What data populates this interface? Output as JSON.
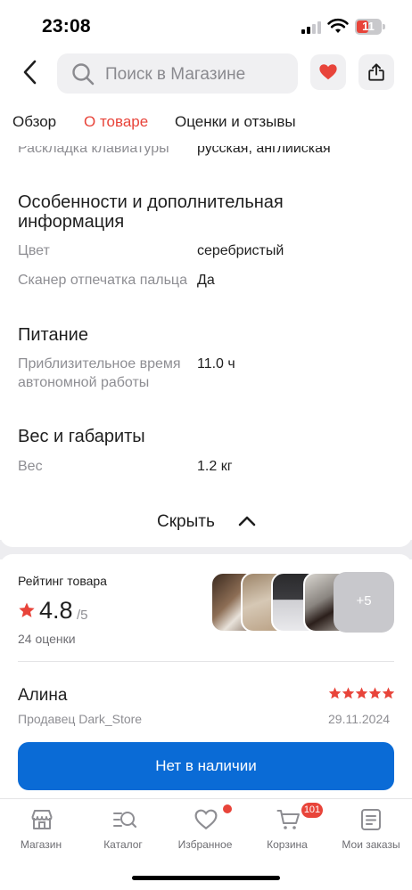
{
  "status_bar": {
    "time": "23:08",
    "battery": "11",
    "signal_icon": "cellular-signal-icon",
    "wifi_icon": "wifi-icon"
  },
  "header": {
    "back_icon": "chevron-left-icon",
    "search_placeholder": "Поиск в Магазине",
    "search_icon": "search-icon",
    "favorite_icon": "heart-icon",
    "share_icon": "share-icon"
  },
  "tabs": [
    {
      "label": "Обзор",
      "active": false
    },
    {
      "label": "О товаре",
      "active": true
    },
    {
      "label": "Оценки и отзывы",
      "active": false
    }
  ],
  "specs": {
    "keyboard_layout": {
      "key": "Раскладка клавиатуры",
      "value": "русская, английская"
    },
    "section_features": "Особенности и дополнительная информация",
    "color": {
      "key": "Цвет",
      "value": "серебристый"
    },
    "fingerprint": {
      "key": "Сканер отпечатка пальца",
      "value": "Да"
    },
    "section_power": "Питание",
    "battery_life": {
      "key": "Приблизительное время автономной работы",
      "value": "11.0 ч"
    },
    "section_weight": "Вес и габариты",
    "weight": {
      "key": "Вес",
      "value": "1.2 кг"
    }
  },
  "collapse": {
    "label": "Скрыть",
    "icon": "chevron-up-icon"
  },
  "rating": {
    "title": "Рейтинг товара",
    "value": "4.8",
    "max": "/5",
    "count": "24 оценки",
    "photos_more": "+5"
  },
  "review": {
    "author": "Алина",
    "seller": "Продавец Dark_Store",
    "date": "29.11.2024",
    "stars": 5
  },
  "cta": {
    "label": "Нет в наличии"
  },
  "bottom_nav": [
    {
      "label": "Магазин",
      "icon": "store-icon"
    },
    {
      "label": "Каталог",
      "icon": "catalog-search-icon"
    },
    {
      "label": "Избранное",
      "icon": "heart-outline-icon"
    },
    {
      "label": "Корзина",
      "icon": "cart-icon",
      "badge": "101"
    },
    {
      "label": "Мои заказы",
      "icon": "orders-icon"
    }
  ],
  "colors": {
    "accent": "#e8443a",
    "primary_button": "#0a6bd6",
    "muted_text": "#8e8e93"
  }
}
